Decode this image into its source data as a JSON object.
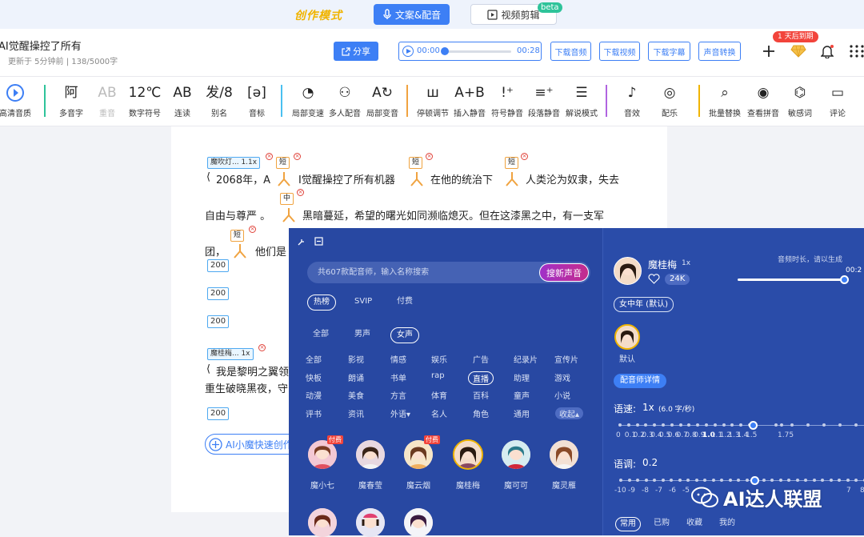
{
  "topbar": {
    "mode": "创作模式",
    "tab_tts": "文案&配音",
    "tab_video": "视频剪辑",
    "beta": "beta"
  },
  "header": {
    "title": "AI觉醒操控了所有",
    "meta": "更新于 5分钟前  |  138/5000字",
    "share": "分享",
    "player": {
      "start": "00:00",
      "end": "00:28",
      "progress": 0.0
    },
    "buttons": [
      "下载音频",
      "下载视频",
      "下载字幕",
      "声音转换"
    ],
    "expire": "1 天后到期"
  },
  "toolbar": {
    "items": [
      {
        "label": "高清音质",
        "icon": "play-circle-icon"
      },
      {
        "label": "多音字",
        "glyph": "阿"
      },
      {
        "label": "重音",
        "glyph": "AB",
        "disabled": true
      },
      {
        "label": "数字符号",
        "glyph": "12℃"
      },
      {
        "label": "连读",
        "glyph": "AB"
      },
      {
        "label": "别名",
        "glyph": "发/8"
      },
      {
        "label": "音标",
        "glyph": "[ə]"
      },
      {
        "label": "局部变速",
        "glyph": "◔"
      },
      {
        "label": "多人配音",
        "glyph": "⚇"
      },
      {
        "label": "局部变音",
        "glyph": "A↻"
      },
      {
        "label": "停顿调节",
        "glyph": "ш"
      },
      {
        "label": "插入静音",
        "glyph": "A+B"
      },
      {
        "label": "符号静音",
        "glyph": "!⁺"
      },
      {
        "label": "段落静音",
        "glyph": "≡⁺"
      },
      {
        "label": "解说模式",
        "glyph": "☰"
      },
      {
        "label": "音效",
        "glyph": "♪"
      },
      {
        "label": "配乐",
        "glyph": "◎"
      },
      {
        "label": "批量替换",
        "glyph": "⌕"
      },
      {
        "label": "查看拼音",
        "glyph": "◉"
      },
      {
        "label": "敏感词",
        "glyph": "⌬"
      },
      {
        "label": "评论",
        "glyph": "▭"
      }
    ]
  },
  "editor": {
    "tag1": "魔吹灯... 1.1x",
    "tag2": "魔桂梅... 1x",
    "short": "短",
    "mid": "中",
    "line1a": "2068年，A",
    "line1b": "I觉醒操控了所有机器",
    "line1c": "在他的统治下",
    "line1d": "人类沦为奴隶，失去",
    "line2a": "自由与尊严 。",
    "line2b": "黑暗蔓延，希望的曙光如同濒临熄灭。但在这漆黑之中，有一支军",
    "line3a": "团，",
    "line3b": "他们是",
    "num": "200",
    "line4": "我是黎明之翼领",
    "line5": "重生破晓黑夜，守",
    "quick": "AI小魔快速创作"
  },
  "panel": {
    "search_placeholder": "共607款配音师，输入名称搜索",
    "search_btn": "搜新声音",
    "tabs": [
      "热榜",
      "SVIP",
      "付费"
    ],
    "gender": [
      "全部",
      "男声",
      "女声"
    ],
    "categories": [
      [
        "全部",
        "影视",
        "情感",
        "娱乐",
        "广告",
        "纪录片",
        "宣传片"
      ],
      [
        "快板",
        "朗诵",
        "书单",
        "rap",
        "直播",
        "助理",
        "游戏"
      ],
      [
        "动漫",
        "美食",
        "方言",
        "体育",
        "百科",
        "童声",
        "小说"
      ],
      [
        "评书",
        "资讯",
        "外语▾",
        "名人",
        "角色",
        "通用",
        "收起▴"
      ]
    ],
    "voices": [
      {
        "name": "魔小七",
        "paid": true
      },
      {
        "name": "魔春莹",
        "paid": false
      },
      {
        "name": "魔云烟",
        "paid": true
      },
      {
        "name": "魔桂梅",
        "paid": false
      },
      {
        "name": "魔可可",
        "paid": false
      },
      {
        "name": "魔灵雁",
        "paid": false
      }
    ],
    "paid_label": "付费",
    "selected": {
      "name": "魔桂梅",
      "speed": "1x",
      "likes": "24K",
      "style": "女中年 (默认)",
      "default": "默认",
      "detail": "配音师详情"
    },
    "duration_label": "音频时长，请以生成",
    "duration_value": "00:2",
    "speed_label": "语速:",
    "speed_value": "1x",
    "speed_unit": "(6.0 字/秒)",
    "speed_ticks": [
      "0",
      "0.1",
      "0.2",
      "0.3",
      "0.4",
      "0.5",
      "0.6",
      "0.7",
      "0.8",
      "0.9",
      "1.0",
      "1.1",
      "1.2",
      "1.3",
      "1.4",
      "1.5",
      "1.75"
    ],
    "tone_label": "语调:",
    "tone_value": "0.2",
    "tone_ticks": [
      "-10",
      "-9",
      "-8",
      "-7",
      "-6",
      "-5"
    ],
    "tone_tick_right": [
      "7",
      "8"
    ],
    "bottom_tabs": [
      "常用",
      "已购",
      "收藏",
      "我的"
    ]
  },
  "watermark": "AI达人联盟",
  "colors": {
    "accent": "#3d7ff5",
    "panel": "#2849a4",
    "danger": "#f2443b",
    "gold": "#f0b400"
  }
}
